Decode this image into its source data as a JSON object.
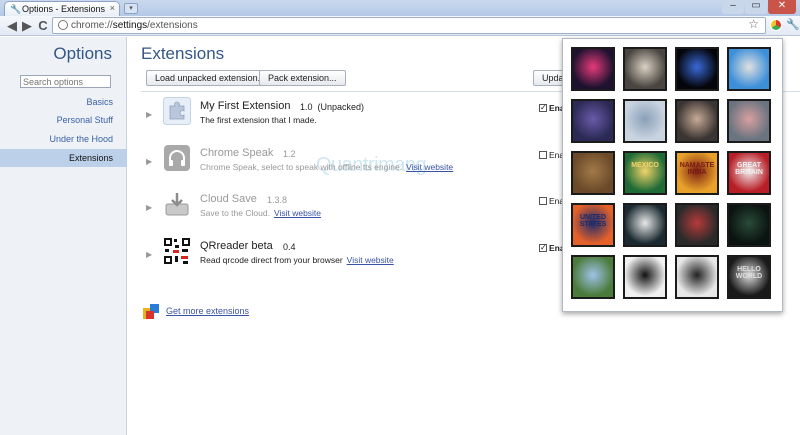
{
  "window": {
    "tab_title": "Options - Extensions",
    "tab_close": "×",
    "new_tab_symbol": "▾",
    "min_symbol": "–",
    "max_symbol": "▭",
    "close_symbol": "✕"
  },
  "toolbar": {
    "back_icon": "◀",
    "forward_icon": "▶",
    "reload_icon": "C",
    "url_prefix": "chrome://",
    "url_host": "settings",
    "url_path": "/extensions",
    "bookmark_icon": "☆",
    "wrench_icon": "🔧"
  },
  "sidebar": {
    "title": "Options",
    "search_placeholder": "Search options",
    "items": [
      {
        "label": "Basics"
      },
      {
        "label": "Personal Stuff"
      },
      {
        "label": "Under the Hood"
      },
      {
        "label": "Extensions",
        "active": true
      }
    ]
  },
  "main": {
    "title": "Extensions",
    "load_unpacked_label": "Load unpacked extension...",
    "pack_label": "Pack extension...",
    "update_label": "Update",
    "extensions": [
      {
        "name": "My First Extension",
        "version": "1.0",
        "version_note": "(Unpacked)",
        "description": "The first extension that I made.",
        "link": "",
        "enabled": true,
        "enable_label": "Ena"
      },
      {
        "name": "Chrome Speak",
        "version": "1.2",
        "version_note": "",
        "description": "Chrome Speak, select to speak with offline tts engine.",
        "link": "Visit website",
        "enabled": false,
        "enable_label": "Ena"
      },
      {
        "name": "Cloud Save",
        "version": "1.3.8",
        "version_note": "",
        "description": "Save to the Cloud.",
        "link": "Visit website",
        "enabled": false,
        "enable_label": "Ena"
      },
      {
        "name": "QRreader beta",
        "version": "0.4",
        "version_note": "",
        "description": "Read qrcode direct from your browser",
        "link": "Visit website",
        "enabled": true,
        "enable_label": "Ena"
      }
    ],
    "get_more_label": "Get more extensions",
    "watermark": "Quantrimang"
  },
  "popup": {
    "tiles": [
      {
        "bg": "#1e1230",
        "accent": "#e83a7c",
        "text": ""
      },
      {
        "bg": "#4a4540",
        "accent": "#d9d2c4",
        "text": ""
      },
      {
        "bg": "#05060c",
        "accent": "#3a6ad8",
        "text": ""
      },
      {
        "bg": "#3d8fd9",
        "accent": "#e0e0e0",
        "text": ""
      },
      {
        "bg": "#2a2a55",
        "accent": "#6a5aa8",
        "text": ""
      },
      {
        "bg": "#c9d4e0",
        "accent": "#8aa0b8",
        "text": ""
      },
      {
        "bg": "#3a3432",
        "accent": "#c8aa96",
        "text": ""
      },
      {
        "bg": "#6a7480",
        "accent": "#d8a0a0",
        "text": ""
      },
      {
        "bg": "#6b4a2a",
        "accent": "#a27a48",
        "text": ""
      },
      {
        "bg": "#1f6b36",
        "accent": "#f2d46a",
        "text": "MEXICO"
      },
      {
        "bg": "#e8a22a",
        "accent": "#7a1e14",
        "text": "NAMASTE INDIA"
      },
      {
        "bg": "#b81e26",
        "accent": "#f0f0f0",
        "text": "GREAT BRITAIN"
      },
      {
        "bg": "#e5612a",
        "accent": "#1d2c6b",
        "text": "UNITED STATES"
      },
      {
        "bg": "#1a2a30",
        "accent": "#e8e8e8",
        "text": ""
      },
      {
        "bg": "#2a2a2a",
        "accent": "#b63a3a",
        "text": ""
      },
      {
        "bg": "#0b1410",
        "accent": "#2a4a38",
        "text": ""
      },
      {
        "bg": "#4b7a3a",
        "accent": "#9ec3e8",
        "text": ""
      },
      {
        "bg": "#f0f0f0",
        "accent": "#111111",
        "text": ""
      },
      {
        "bg": "#e8e8e8",
        "accent": "#222222",
        "text": ""
      },
      {
        "bg": "#1a1a1a",
        "accent": "#dddddd",
        "text": "HELLO WORLD"
      }
    ]
  },
  "colors": {
    "link": "#3953a4",
    "title": "#345688",
    "sidebar_bg": "#eef2f7",
    "sidebar_active": "#bcd0ea"
  }
}
